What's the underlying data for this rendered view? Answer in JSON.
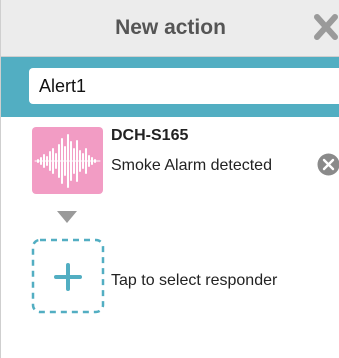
{
  "header": {
    "title": "New action",
    "close_icon": "close-x-icon"
  },
  "action_name": {
    "value": "Alert1",
    "placeholder": ""
  },
  "trigger": {
    "device": "DCH-S165",
    "event": "Smoke Alarm detected",
    "icon": "sound-wave-icon",
    "icon_bg_color": "#f29cc4",
    "remove_icon": "remove-circle-icon"
  },
  "flow_arrow_icon": "triangle-down-icon",
  "responder": {
    "label": "Tap to select responder",
    "icon": "plus-icon"
  },
  "colors": {
    "accent": "#52aec2",
    "header_bg": "#ececec",
    "title_text": "#555555"
  }
}
